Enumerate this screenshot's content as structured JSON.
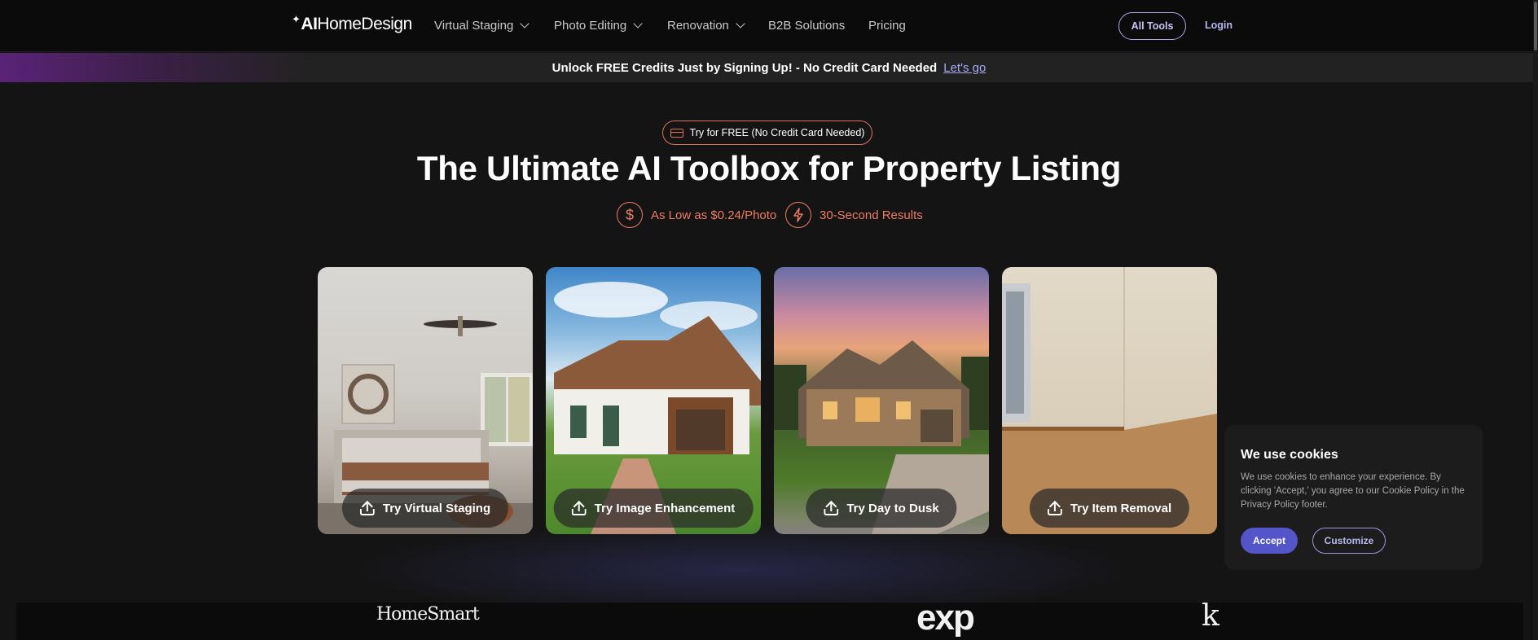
{
  "nav": {
    "logo_ai": "AI",
    "logo_rest": "HomeDesign",
    "items": [
      {
        "label": "Virtual Staging",
        "dropdown": true
      },
      {
        "label": "Photo Editing",
        "dropdown": true
      },
      {
        "label": "Renovation",
        "dropdown": true
      },
      {
        "label": "B2B Solutions",
        "dropdown": false
      },
      {
        "label": "Pricing",
        "dropdown": false
      }
    ],
    "all_tools": "All Tools",
    "login": "Login"
  },
  "promo": {
    "text": "Unlock FREE Credits Just by Signing Up! - No Credit Card Needed",
    "link": "Let's go"
  },
  "hero": {
    "badge": "Try for FREE (No Credit Card Needed)",
    "title": "The Ultimate AI Toolbox for Property Listing",
    "features": [
      {
        "icon": "dollar-icon",
        "label": "As Low as $0.24/Photo"
      },
      {
        "icon": "lightning-icon",
        "label": "30-Second Results"
      }
    ]
  },
  "cards": [
    {
      "label": "Try Virtual Staging",
      "icon": "upload-icon"
    },
    {
      "label": "Try Image Enhancement",
      "icon": "upload-icon"
    },
    {
      "label": "Try Day to Dusk",
      "icon": "upload-icon"
    },
    {
      "label": "Try Item Removal",
      "icon": "upload-icon"
    }
  ],
  "cookie": {
    "title": "We use cookies",
    "text": "We use cookies to enhance your experience. By clicking 'Accept,' you agree to our Cookie Policy in the Privacy Policy footer.",
    "accept": "Accept",
    "customize": "Customize"
  },
  "partners": {
    "homesmart": "HomeSmart",
    "exp": "exp",
    "third": "k"
  },
  "colors": {
    "accent": "#ef7c62",
    "primary_button": "#5355c9",
    "link": "#a9a9f8"
  }
}
